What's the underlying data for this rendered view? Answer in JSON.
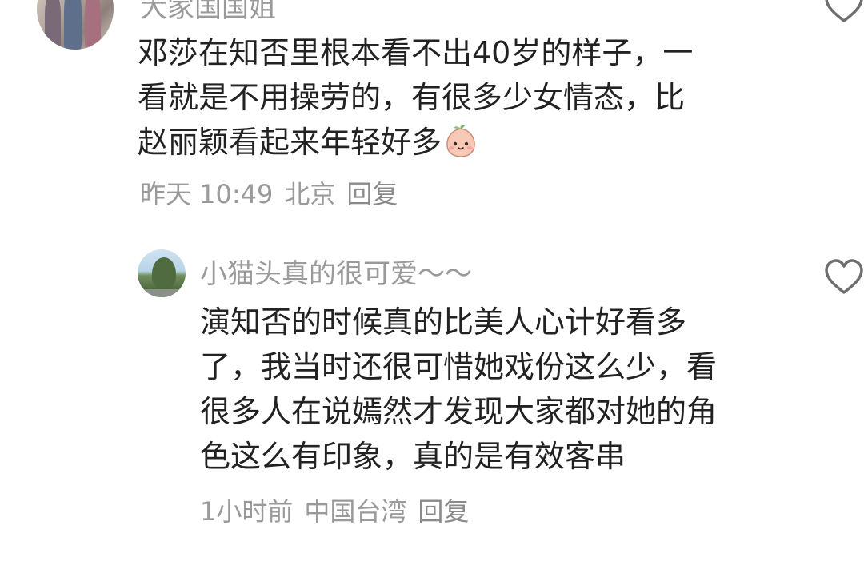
{
  "comments": [
    {
      "username": "大家国国姐",
      "text_lines": [
        "邓莎在知否里根本看不出40岁的样子，一",
        "看就是不用操劳的，有很多少女情态，比",
        "赵丽颖看起来年轻好多"
      ],
      "emoji": "peach-face-emoji",
      "time": "昨天 10:49",
      "location": "北京",
      "reply_label": "回复",
      "icons": {
        "avatar": "user-avatar-group-photo",
        "like": "heart-outline-icon"
      }
    },
    {
      "username": "小猫头真的很可爱～～",
      "text_lines": [
        "演知否的时候真的比美人心计好看多",
        "了，我当时还很可惜她戏份这么少，看",
        "很多人在说嫣然才发现大家都对她的角",
        "色这么有印象，真的是有效客串"
      ],
      "time": "1小时前",
      "location": "中国台湾",
      "reply_label": "回复",
      "icons": {
        "avatar": "user-avatar-tree-photo",
        "like": "heart-outline-icon"
      }
    }
  ],
  "colors": {
    "text_primary": "#222222",
    "text_secondary": "#9a9a9a",
    "background": "#ffffff"
  }
}
